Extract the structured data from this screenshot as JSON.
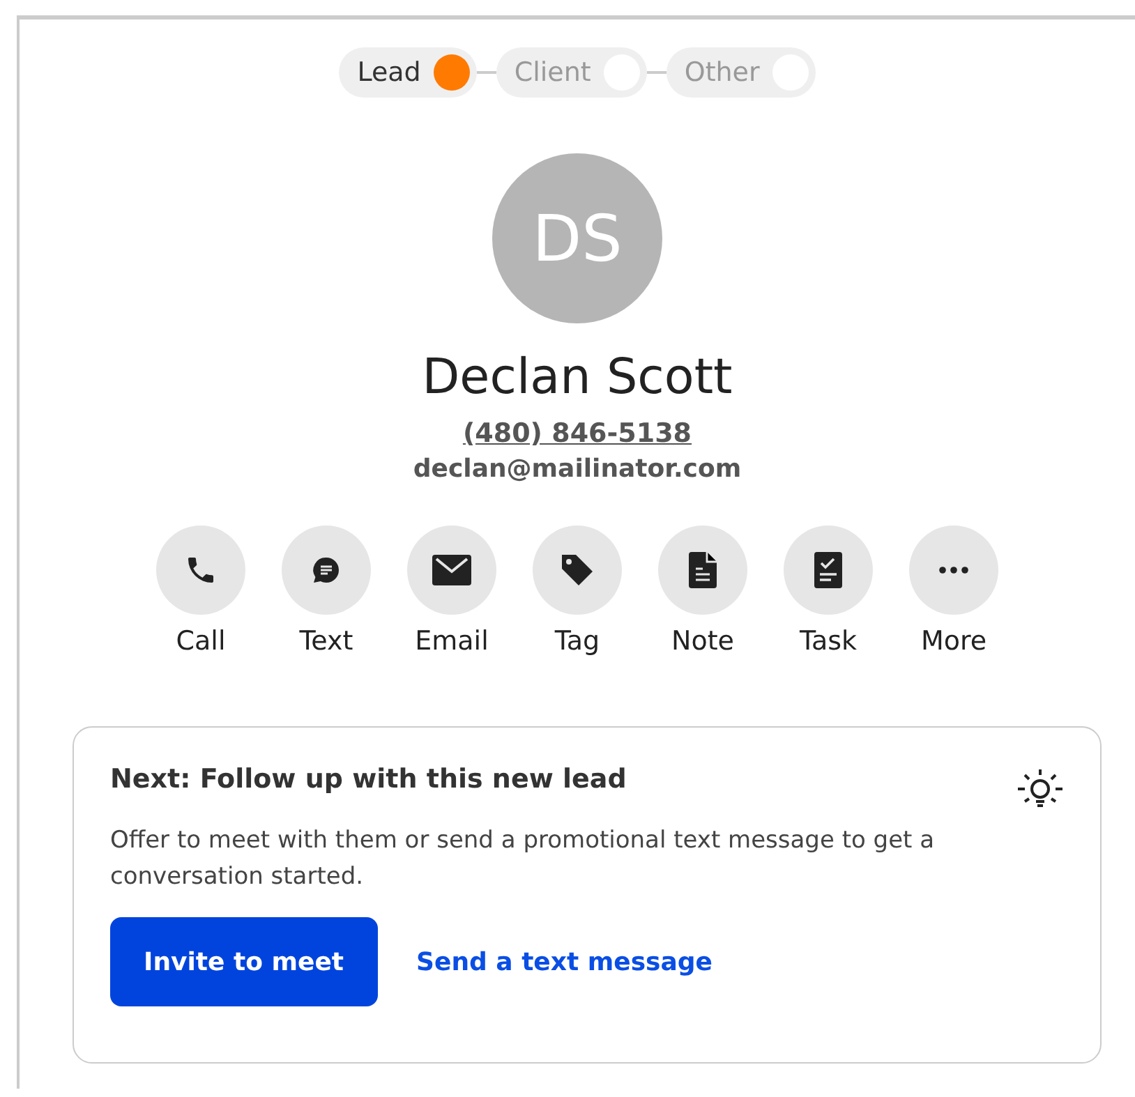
{
  "stages": [
    {
      "label": "Lead",
      "selected": true
    },
    {
      "label": "Client",
      "selected": false
    },
    {
      "label": "Other",
      "selected": false
    }
  ],
  "contact": {
    "initials": "DS",
    "name": "Declan Scott",
    "phone": "(480) 846-5138",
    "email": "declan@mailinator.com"
  },
  "actions": [
    {
      "kind": "call",
      "label": "Call"
    },
    {
      "kind": "text",
      "label": "Text"
    },
    {
      "kind": "email",
      "label": "Email"
    },
    {
      "kind": "tag",
      "label": "Tag"
    },
    {
      "kind": "note",
      "label": "Note"
    },
    {
      "kind": "task",
      "label": "Task"
    },
    {
      "kind": "more",
      "label": "More"
    }
  ],
  "next_step": {
    "title": "Next: Follow up with this new lead",
    "description": "Offer to meet with them or send a promotional text message to get a conversation started.",
    "primary_button": "Invite to meet",
    "link": "Send a text message"
  }
}
